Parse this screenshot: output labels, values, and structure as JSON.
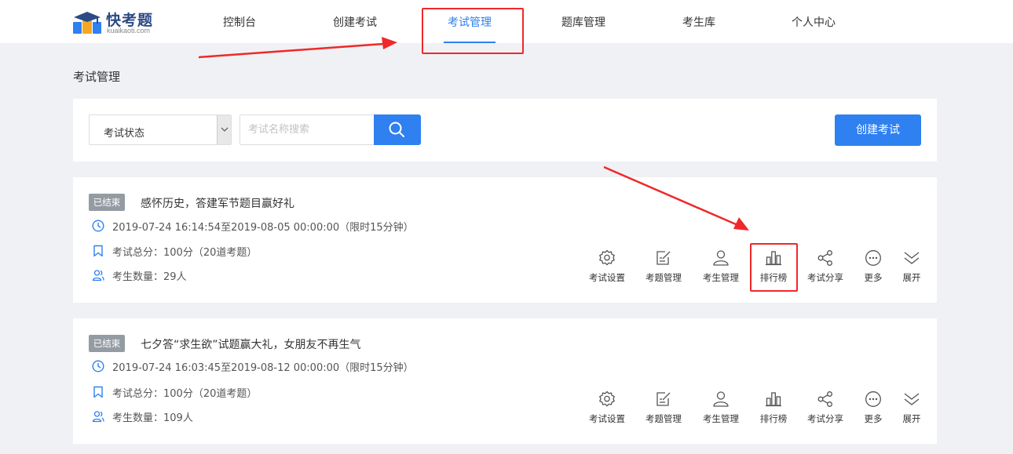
{
  "logo": {
    "name": "快考题",
    "sub": "kuaikaoti.com"
  },
  "nav": [
    {
      "label": "控制台"
    },
    {
      "label": "创建考试"
    },
    {
      "label": "考试管理",
      "active": true
    },
    {
      "label": "题库管理"
    },
    {
      "label": "考生库"
    },
    {
      "label": "个人中心"
    }
  ],
  "page_title": "考试管理",
  "filters": {
    "status_select": "考试状态",
    "search_placeholder": "考试名称搜索",
    "create_button": "创建考试"
  },
  "exams": [
    {
      "status": "已结束",
      "title": "感怀历史，答建军节题目赢好礼",
      "time": "2019-07-24 16:14:54至2019-08-05 00:00:00（限时15分钟）",
      "score": "考试总分：100分（20道考题）",
      "examinees": "考生数量：29人"
    },
    {
      "status": "已结束",
      "title": "七夕答“求生欲”试题赢大礼，女朋友不再生气",
      "time": "2019-07-24 16:03:45至2019-08-12 00:00:00（限时15分钟）",
      "score": "考试总分：100分（20道考题）",
      "examinees": "考生数量：109人"
    }
  ],
  "actions": [
    {
      "label": "考试设置",
      "icon": "gear-icon"
    },
    {
      "label": "考题管理",
      "icon": "edit-icon"
    },
    {
      "label": "考生管理",
      "icon": "user-icon"
    },
    {
      "label": "排行榜",
      "icon": "bar-chart-icon"
    },
    {
      "label": "考试分享",
      "icon": "share-icon"
    },
    {
      "label": "更多",
      "icon": "more-icon"
    },
    {
      "label": "展开",
      "icon": "chevron-double-down-icon"
    }
  ],
  "colors": {
    "accent": "#2f80f0",
    "annotation": "#f0282a",
    "badge": "#949ba3",
    "background": "#f0f1f4"
  }
}
